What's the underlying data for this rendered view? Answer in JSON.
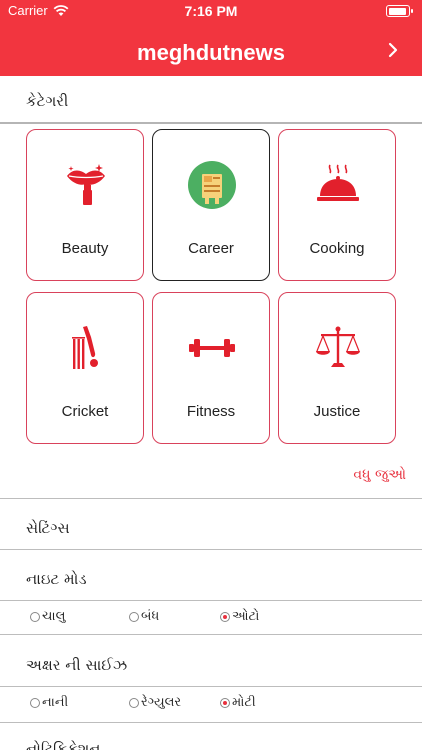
{
  "status_bar": {
    "carrier": "Carrier",
    "time": "7:16 PM"
  },
  "header": {
    "title": "meghdutnews"
  },
  "categories": {
    "heading": "કેટેગરી",
    "items": [
      {
        "label": "Beauty",
        "icon": "lips-lipstick-icon"
      },
      {
        "label": "Career",
        "icon": "career-icon"
      },
      {
        "label": "Cooking",
        "icon": "cloche-icon"
      },
      {
        "label": "Cricket",
        "icon": "cricket-bat-icon"
      },
      {
        "label": "Fitness",
        "icon": "dumbbell-icon"
      },
      {
        "label": "Justice",
        "icon": "scales-icon"
      }
    ],
    "selected": "Career",
    "more_label": "વધુ જુઓ"
  },
  "settings": {
    "heading": "સેટિંગ્સ",
    "night_mode": {
      "label": "નાઇટ મોડ",
      "options": [
        "ચાલુ",
        "બંધ",
        "ઓટો"
      ],
      "selected": "ઓટો"
    },
    "font_size": {
      "label": "અક્ષર ની સાઈઝ",
      "options": [
        "નાની",
        "રેગ્યુલર",
        "મોટી"
      ],
      "selected": "મોટી"
    },
    "next_partial": "નોટિફિકેશન"
  },
  "colors": {
    "brand": "#f2353f",
    "card_border": "#d9425b",
    "link": "#e8323f"
  }
}
